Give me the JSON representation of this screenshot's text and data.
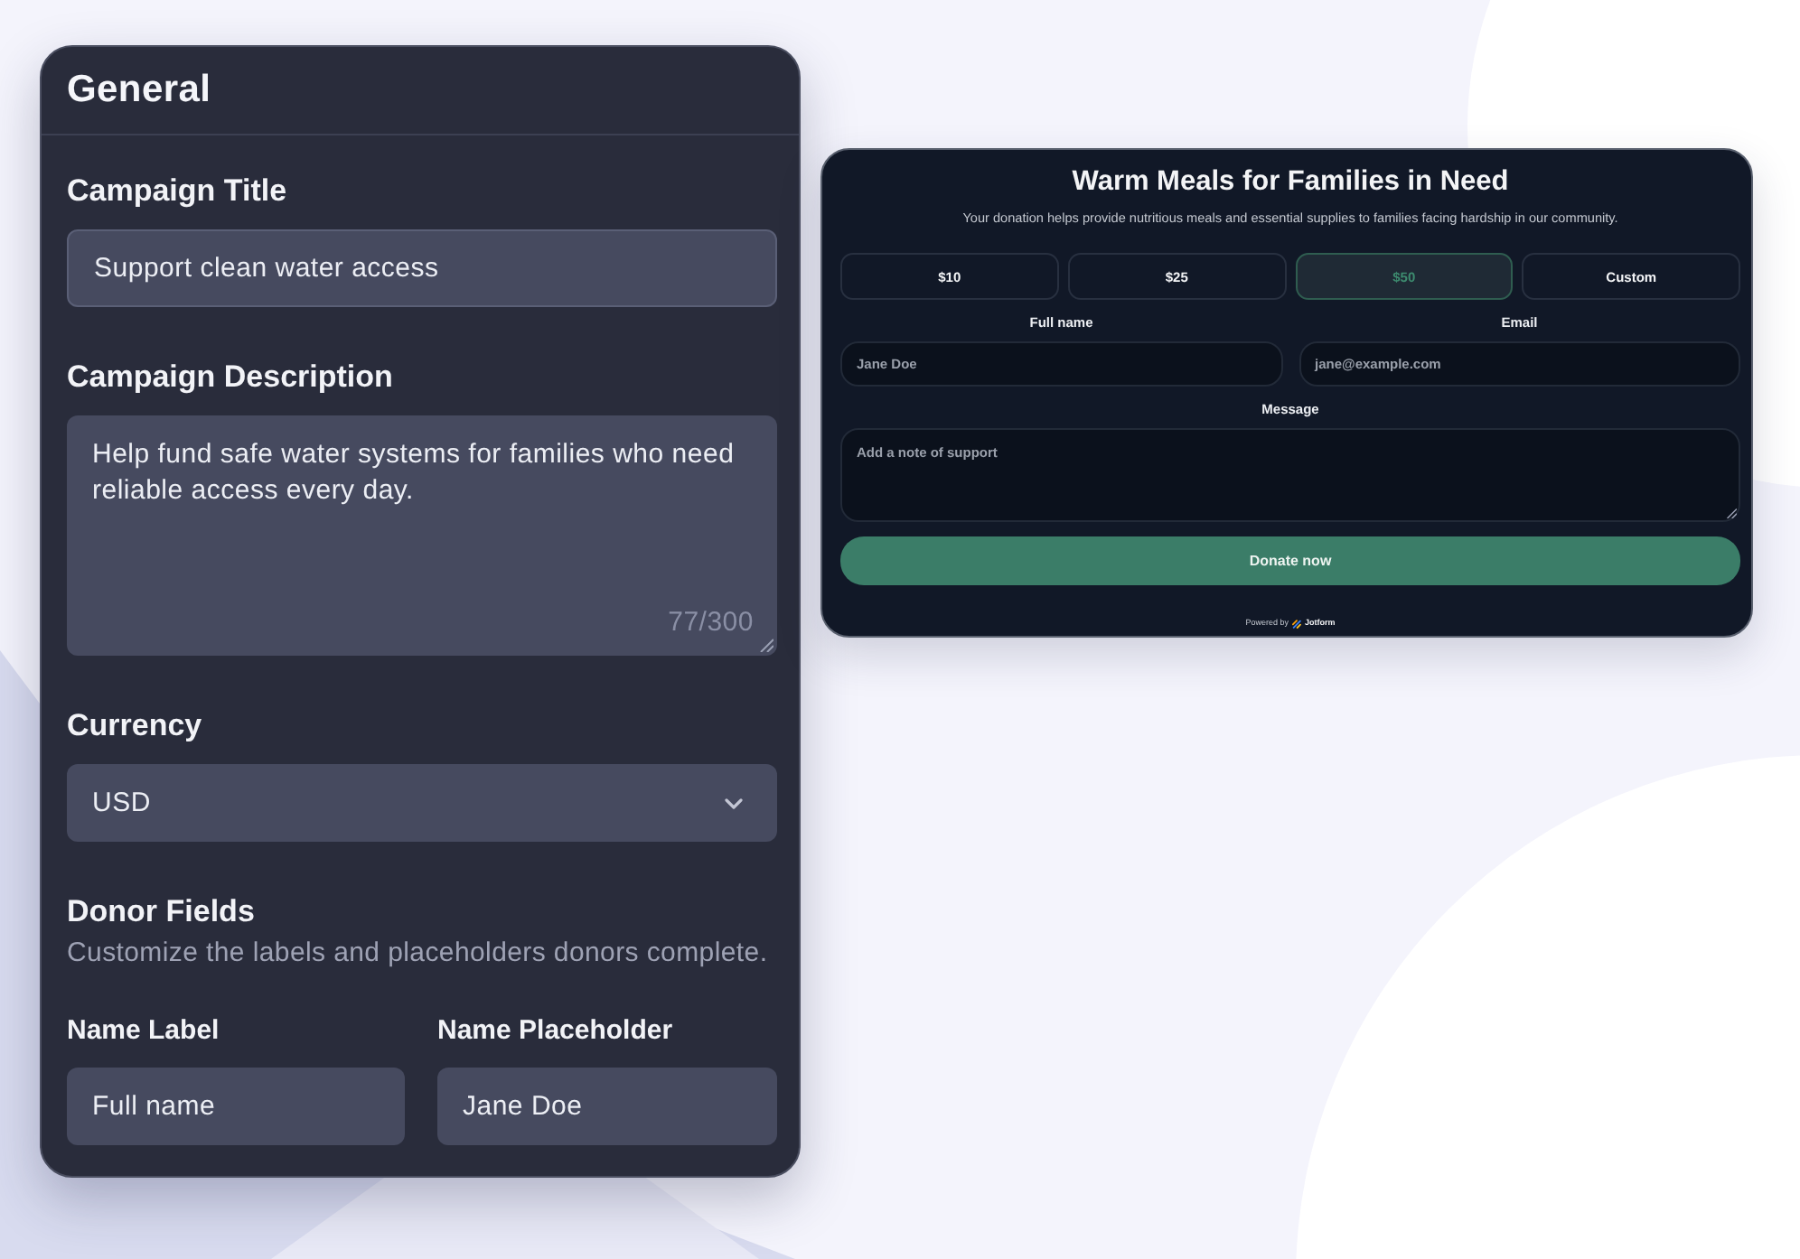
{
  "settings_panel": {
    "title": "General",
    "fields": [
      {
        "kind": "text",
        "label": "Campaign Title",
        "value": "Support clean water access"
      },
      {
        "kind": "textarea",
        "label": "Campaign Description",
        "value": "Help fund safe water systems for families who need reliable access every day.",
        "counter": "77/300"
      },
      {
        "kind": "select",
        "label": "Currency",
        "value": "USD"
      }
    ],
    "section": {
      "title": "Donor Fields",
      "description": "Customize the labels and placeholders donors complete."
    },
    "donor_fields": [
      {
        "label": "Name Label",
        "value": "Full name"
      },
      {
        "label": "Name Placeholder",
        "value": "Jane Doe"
      }
    ]
  },
  "preview": {
    "title": "Warm Meals for Families in Need",
    "subtitle": "Your donation helps provide nutritious meals and essential supplies to families facing hardship in our community.",
    "amounts": [
      {
        "label": "$10",
        "selected": false
      },
      {
        "label": "$25",
        "selected": false
      },
      {
        "label": "$50",
        "selected": true
      },
      {
        "label": "Custom",
        "selected": false
      }
    ],
    "fields": [
      {
        "kind": "input",
        "label": "Full name",
        "placeholder": "Jane Doe"
      },
      {
        "kind": "input",
        "label": "Email",
        "placeholder": "jane@example.com"
      },
      {
        "kind": "textarea",
        "label": "Message",
        "placeholder": "Add a note of support"
      }
    ],
    "submit": "Donate now",
    "footer": {
      "prefix": "Powered by",
      "brand": "Jotform"
    }
  }
}
